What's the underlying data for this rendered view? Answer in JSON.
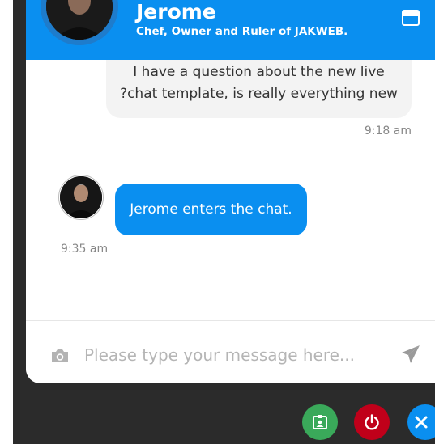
{
  "header": {
    "name": "Jerome",
    "role": "Chef, Owner and Ruler of JAKWEB."
  },
  "messages": [
    {
      "direction": "out",
      "lines": [
        "I have a question about the new live",
        "?chat template, is really everything new"
      ],
      "time": "9:18 am"
    },
    {
      "direction": "in",
      "text": "Jerome enters the chat.",
      "time": "9:35 am"
    }
  ],
  "input": {
    "placeholder": "Please type your message here..."
  },
  "icons": {
    "minimize": "minimize-icon",
    "camera": "camera-icon",
    "send": "send-icon",
    "contact_card": "contact-card-icon",
    "power": "power-icon",
    "close": "close-icon"
  },
  "colors": {
    "accent": "#0a8ff0",
    "green": "#3aa95a",
    "red": "#c0001a",
    "dark": "#2b2b2b"
  }
}
